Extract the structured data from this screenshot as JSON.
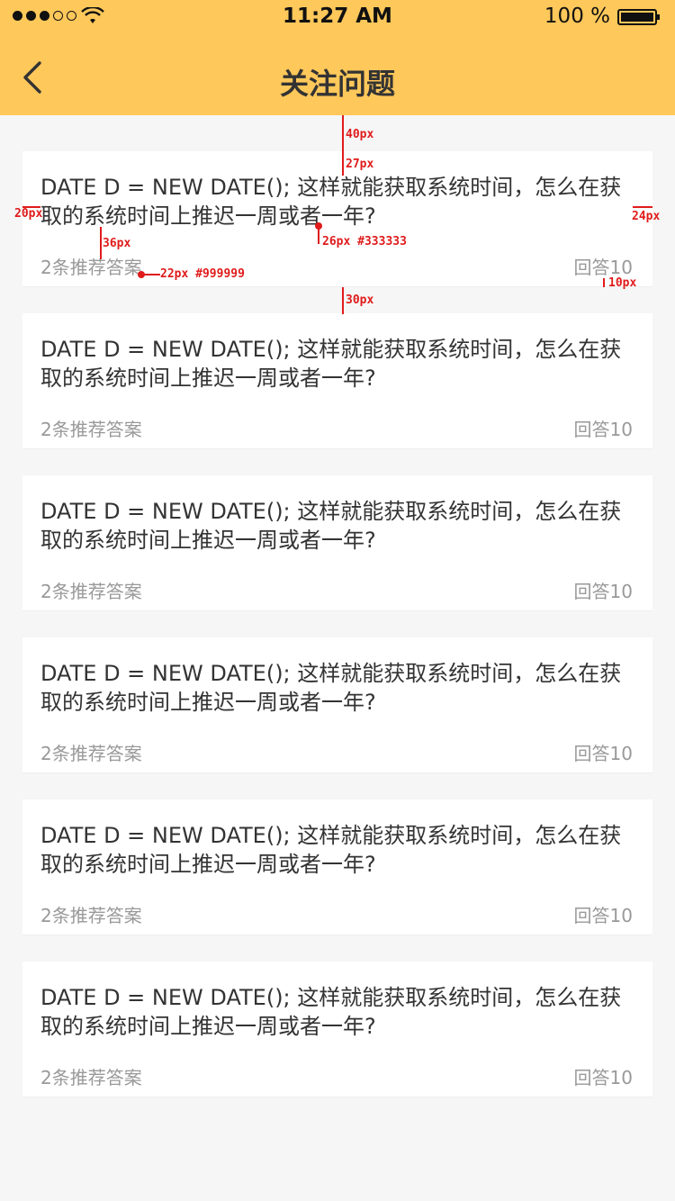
{
  "status_bar": {
    "time": "11:27 AM",
    "battery": "100 %",
    "icons": [
      "signal-dots",
      "wifi-icon",
      "battery-icon"
    ]
  },
  "nav": {
    "title": "关注问题",
    "back_icon": "chevron-left-icon"
  },
  "colors": {
    "header_bg": "#ffc85a",
    "primary_text": "#333333",
    "secondary_text": "#999999",
    "page_bg": "#f6f6f6",
    "annotation": "#e01b1b"
  },
  "questions": [
    {
      "title": "DATE D = NEW DATE(); 这样就能获取系统时间，怎么在获取的系统时间上推迟一周或者一年?",
      "recommend": "2条推荐答案",
      "answers": "回答10"
    },
    {
      "title": "DATE D = NEW DATE(); 这样就能获取系统时间，怎么在获取的系统时间上推迟一周或者一年?",
      "recommend": "2条推荐答案",
      "answers": "回答10"
    },
    {
      "title": "DATE D = NEW DATE(); 这样就能获取系统时间，怎么在获取的系统时间上推迟一周或者一年?",
      "recommend": "2条推荐答案",
      "answers": "回答10"
    },
    {
      "title": "DATE D = NEW DATE(); 这样就能获取系统时间，怎么在获取的系统时间上推迟一周或者一年?",
      "recommend": "2条推荐答案",
      "answers": "回答10"
    },
    {
      "title": "DATE D = NEW DATE(); 这样就能获取系统时间，怎么在获取的系统时间上推迟一周或者一年?",
      "recommend": "2条推荐答案",
      "answers": "回答10"
    },
    {
      "title": "DATE D = NEW DATE(); 这样就能获取系统时间，怎么在获取的系统时间上推迟一周或者一年?",
      "recommend": "2条推荐答案",
      "answers": "回答10"
    }
  ],
  "annotations": {
    "a40": "40px",
    "a27": "27px",
    "a20": "20px",
    "a24": "24px",
    "a36": "36px",
    "a26": "26px #333333",
    "a22": "22px #999999",
    "a10": "10px",
    "a30": "30px"
  }
}
